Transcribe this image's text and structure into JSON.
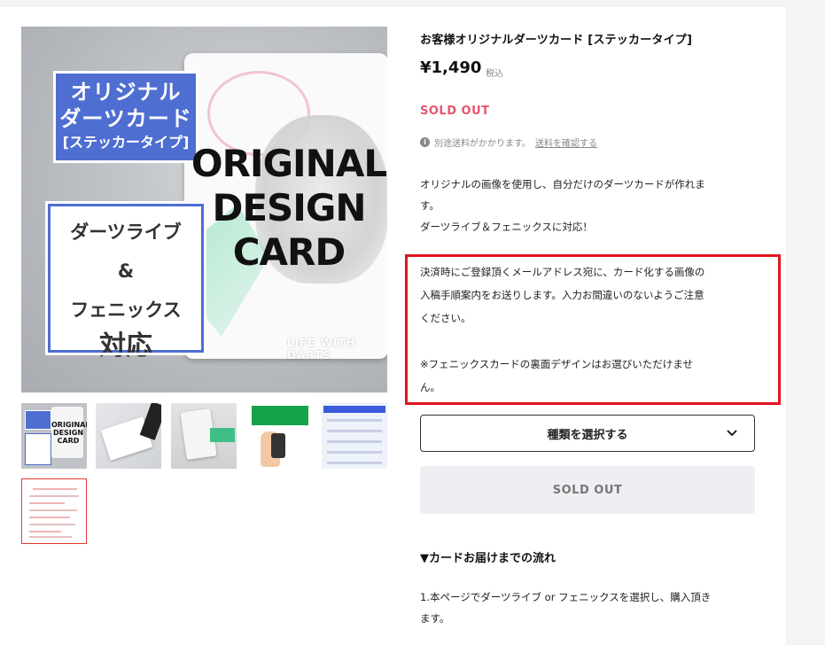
{
  "product": {
    "title": "お客様オリジナルダーツカード [ステッカータイプ]",
    "price": "¥1,490",
    "tax_label": "税込",
    "status": "SOLD OUT",
    "shipping_text": "別途送料がかかります。",
    "shipping_link": "送料を確認する",
    "description": [
      "オリジナルの画像を使用し、自分だけのダーツカードが作れま",
      "す。",
      "ダーツライブ＆フェニックスに対応！"
    ],
    "notice": [
      "決済時にご登録頂くメールアドレス宛に、カード化する画像の",
      "入稿手順案内をお送りします。入力お間違いのないようご注意",
      "ください。",
      "",
      "※フェニックスカードの裏面デザインはお選びいただけませ",
      "ん。"
    ],
    "variant_select_label": "種類を選択する",
    "soldout_button": "SOLD OUT",
    "flow_heading": "▼カードお届けまでの流れ",
    "flow_steps": [
      "1.本ページでダーツライブ or フェニックスを選択し、購入頂き",
      "ます。"
    ]
  },
  "main_image": {
    "title_line1": "オリジナル",
    "title_line2": "ダーツカード",
    "title_line3": "[ステッカータイプ]",
    "compat_line1": "ダーツライブ",
    "compat_line2": "&",
    "compat_line3": "フェニックス",
    "compat_line4": "対応",
    "big_line1": "ORIGINAL",
    "big_line2": "DESIGN",
    "big_line3": "CARD",
    "brand": "LIFE WITH DARTS"
  },
  "thumbnails": {
    "t1": {
      "big1": "ORIGINAL",
      "big2": "DESIGN",
      "big3": "CARD"
    }
  },
  "colors": {
    "accent_blue": "#4f6ed1",
    "sold_out_red": "#e5566d",
    "highlight_red": "#e2151f"
  }
}
